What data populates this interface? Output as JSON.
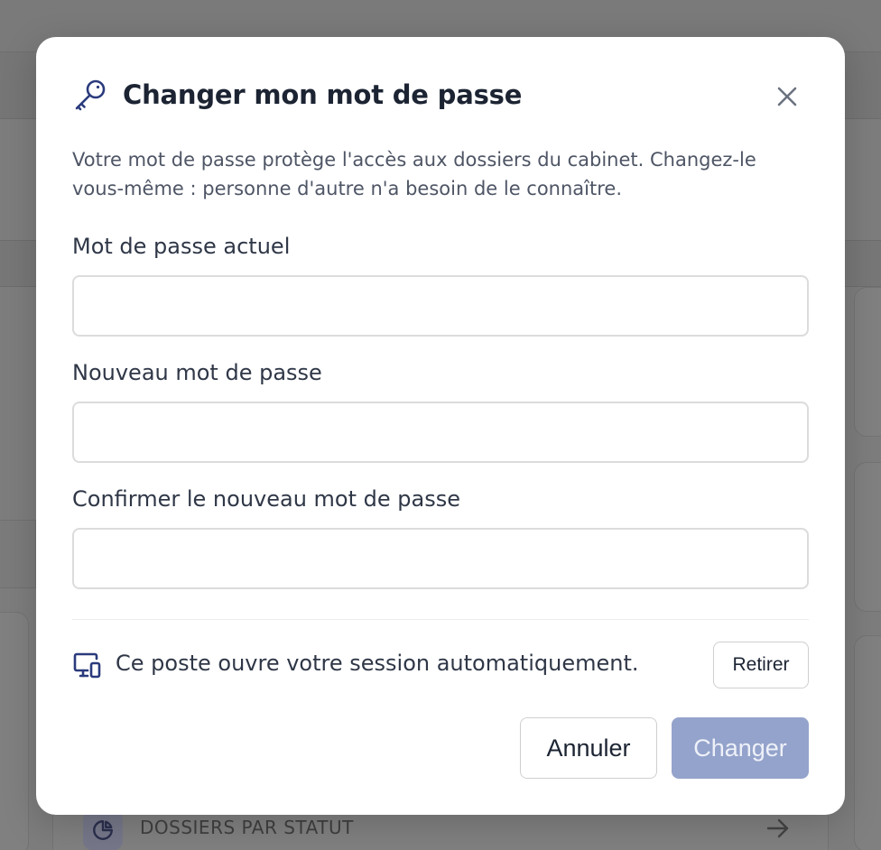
{
  "modal": {
    "title": "Changer mon mot de passe",
    "title_icon": "key-icon",
    "close_icon": "close-icon",
    "intro": "Votre mot de passe protège l'accès aux dossiers du cabinet. Changez-le vous-même : personne d'autre n'a besoin de le connaître.",
    "fields": [
      {
        "label": "Mot de passe actuel",
        "value": ""
      },
      {
        "label": "Nouveau mot de passe",
        "value": ""
      },
      {
        "label": "Confirmer le nouveau mot de passe",
        "value": ""
      }
    ],
    "session": {
      "icon": "devices-icon",
      "text": "Ce poste ouvre votre session automatiquement.",
      "remove_label": "Retirer"
    },
    "actions": {
      "cancel_label": "Annuler",
      "submit_label": "Changer",
      "submit_enabled": false
    }
  },
  "background": {
    "panel_title": "DOSSIERS PAR STATUT",
    "panel_icon": "pie-chart-icon",
    "panel_arrow": "arrow-right-icon"
  },
  "colors": {
    "overlay": "#7d7d7d",
    "title": "#1c2433",
    "accent_icon": "#2a3a7c",
    "submit_disabled": "#94a3cb"
  }
}
